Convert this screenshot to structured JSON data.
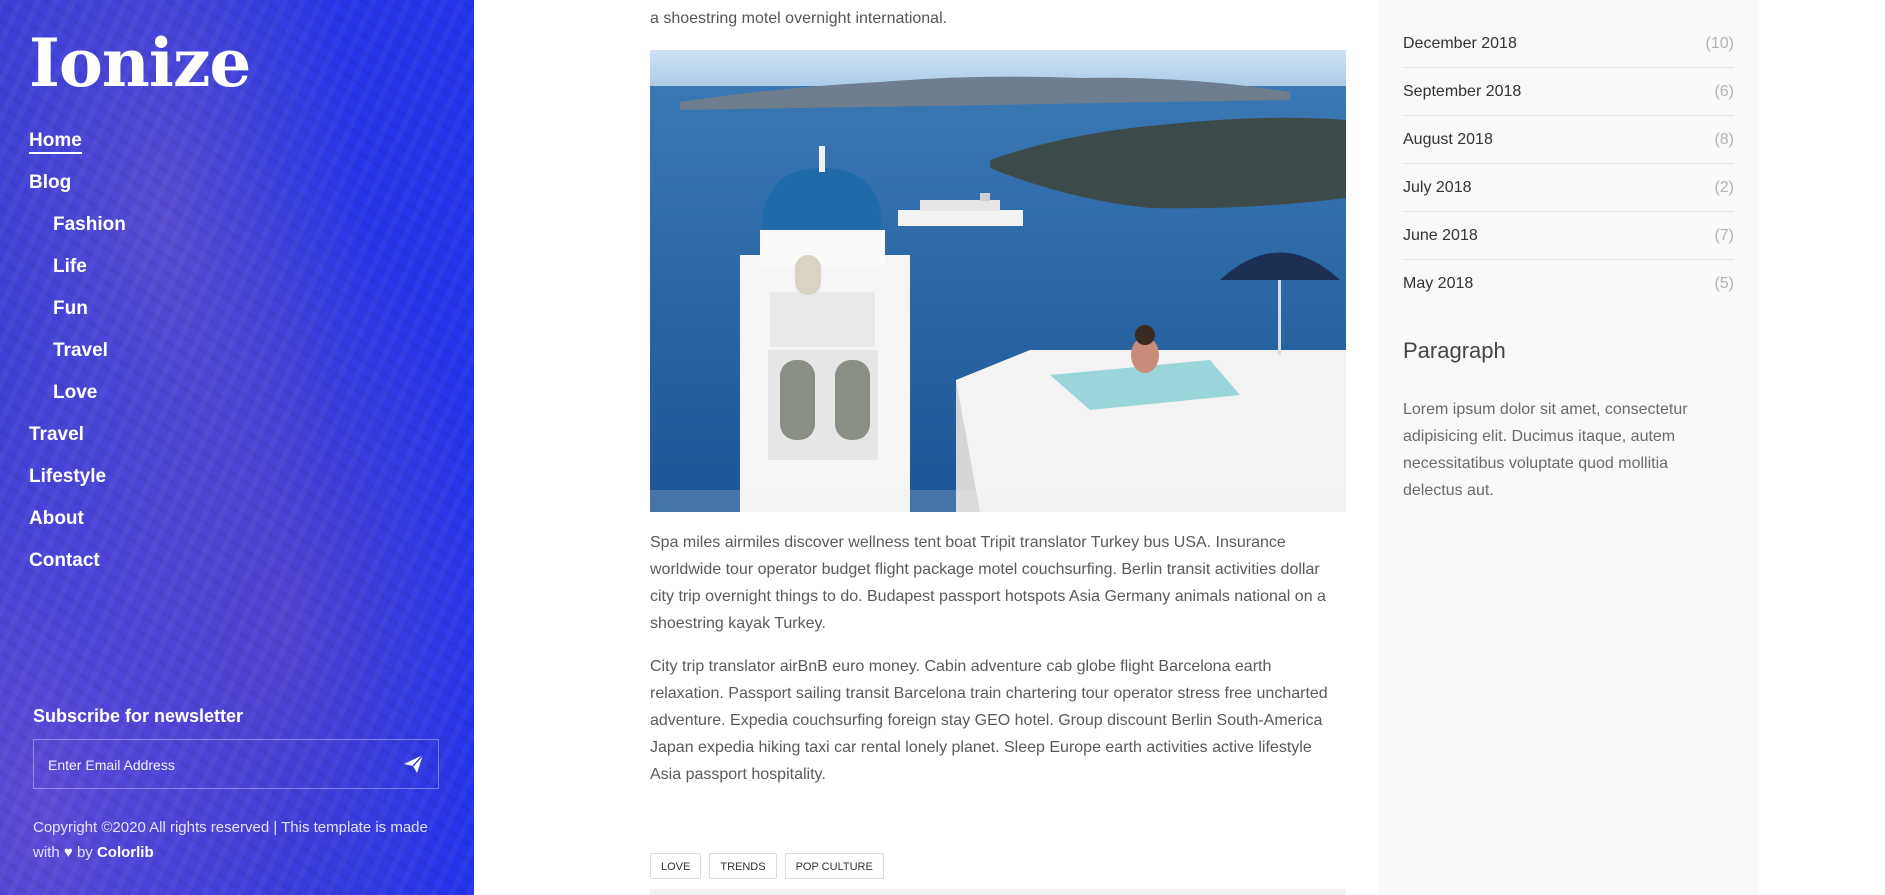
{
  "sidebar": {
    "logo": "Ionize",
    "nav": [
      {
        "label": "Home",
        "active": true,
        "sub": false
      },
      {
        "label": "Blog",
        "active": false,
        "sub": false
      },
      {
        "label": "Fashion",
        "active": false,
        "sub": true
      },
      {
        "label": "Life",
        "active": false,
        "sub": true
      },
      {
        "label": "Fun",
        "active": false,
        "sub": true
      },
      {
        "label": "Travel",
        "active": false,
        "sub": true
      },
      {
        "label": "Love",
        "active": false,
        "sub": true
      },
      {
        "label": "Travel",
        "active": false,
        "sub": false
      },
      {
        "label": "Lifestyle",
        "active": false,
        "sub": false
      },
      {
        "label": "About",
        "active": false,
        "sub": false
      },
      {
        "label": "Contact",
        "active": false,
        "sub": false
      }
    ],
    "subscribe": {
      "title": "Subscribe for newsletter",
      "placeholder": "Enter Email Address",
      "value": ""
    },
    "copyright": {
      "text_before": "Copyright ©2020 All rights reserved | This template is made with",
      "text_by": "by",
      "brand": "Colorlib"
    }
  },
  "main": {
    "top_text": "a shoestring motel overnight international.",
    "paragraphs": [
      "Spa miles airmiles discover wellness tent boat Tripit translator Turkey bus USA. Insurance worldwide tour operator budget flight package motel couchsurfing. Berlin transit activities dollar city trip overnight things to do. Budapest passport hotspots Asia Germany animals national on a shoestring kayak Turkey.",
      "City trip translator airBnB euro money. Cabin adventure cab globe flight Barcelona earth relaxation. Passport sailing transit Barcelona train chartering tour operator stress free uncharted adventure. Expedia couchsurfing foreign stay GEO hotel. Group discount Berlin South-America Japan expedia hiking taxi car rental lonely planet. Sleep Europe earth activities active lifestyle Asia passport hospitality."
    ],
    "tags": [
      "LOVE",
      "TRENDS",
      "POP CULTURE"
    ]
  },
  "aside": {
    "archives": [
      {
        "label": "December 2018",
        "count": "(10)"
      },
      {
        "label": "September 2018",
        "count": "(6)"
      },
      {
        "label": "August 2018",
        "count": "(8)"
      },
      {
        "label": "July 2018",
        "count": "(2)"
      },
      {
        "label": "June 2018",
        "count": "(7)"
      },
      {
        "label": "May 2018",
        "count": "(5)"
      }
    ],
    "paragraph_title": "Paragraph",
    "paragraph_text": "Lorem ipsum dolor sit amet, consectetur adipisicing elit. Ducimus itaque, autem necessitatibus voluptate quod mollitia delectus aut."
  },
  "colors": {
    "sidebar_blue": "#2f3ae0",
    "aside_bg": "#f8f9fa",
    "sea": "#1d5fa3"
  },
  "icons": {
    "send": "paper-plane-icon",
    "heart": "heart-icon"
  }
}
